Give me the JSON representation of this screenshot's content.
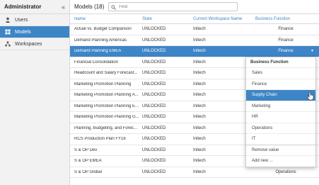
{
  "sidebar": {
    "title": "Administrator",
    "collapse_glyph": "«",
    "items": [
      {
        "label": "Users",
        "icon": "user-icon"
      },
      {
        "label": "Models",
        "icon": "models-icon"
      },
      {
        "label": "Workspaces",
        "icon": "workspaces-icon"
      }
    ]
  },
  "header": {
    "title": "Models (18)",
    "search_placeholder": "Find"
  },
  "table": {
    "columns": [
      "Name",
      "State",
      "Current Workspace Name",
      "Business Function"
    ],
    "rows": [
      {
        "name": "Actual vs. Budget Comparison",
        "state": "UNLOCKED",
        "workspace": "Initech",
        "function": "Finance"
      },
      {
        "name": "Demand Planning Americas",
        "state": "UNLOCKED",
        "workspace": "Initech",
        "function": "Finance"
      },
      {
        "name": "Demand Planning EMEA",
        "state": "UNLOCKED",
        "workspace": "Initech",
        "function": "Finance"
      },
      {
        "name": "Financial Consolidation",
        "state": "UNLOCKED",
        "workspace": "Initech",
        "function": ""
      },
      {
        "name": "Headcount and Salary Forecast...",
        "state": "UNLOCKED",
        "workspace": "Initech",
        "function": ""
      },
      {
        "name": "Marketing Promotion Planning",
        "state": "UNLOCKED",
        "workspace": "Initech",
        "function": ""
      },
      {
        "name": "Marketing Promotion Planning A...",
        "state": "UNLOCKED",
        "workspace": "Initech",
        "function": ""
      },
      {
        "name": "Marketing Promotion Planning E...",
        "state": "UNLOCKED",
        "workspace": "Initech",
        "function": ""
      },
      {
        "name": "Marketing Promotion Planning G...",
        "state": "UNLOCKED",
        "workspace": "Initech",
        "function": ""
      },
      {
        "name": "Planning, Budgeting, and Forec...",
        "state": "UNLOCKED",
        "workspace": "Initech",
        "function": ""
      },
      {
        "name": "RCS Production Plan FY16",
        "state": "UNLOCKED",
        "workspace": "Initech",
        "function": ""
      },
      {
        "name": "S & OP Dev",
        "state": "UNLOCKED",
        "workspace": "Initech",
        "function": ""
      },
      {
        "name": "S & OP EMEA",
        "state": "UNLOCKED",
        "workspace": "Initech",
        "function": ""
      },
      {
        "name": "S & OP Global",
        "state": "UNLOCKED",
        "workspace": "Initech",
        "function": "Operations"
      }
    ]
  },
  "dropdown": {
    "heading": "Business Function",
    "options": [
      "Sales",
      "Finance",
      "Supply Chain",
      "Marketing",
      "HR",
      "Operations",
      "IT"
    ],
    "actions": [
      "Remove value",
      "Add new ..."
    ]
  },
  "colors": {
    "accent": "#3d85c6",
    "sidebar_bg": "#f2f2f2"
  }
}
